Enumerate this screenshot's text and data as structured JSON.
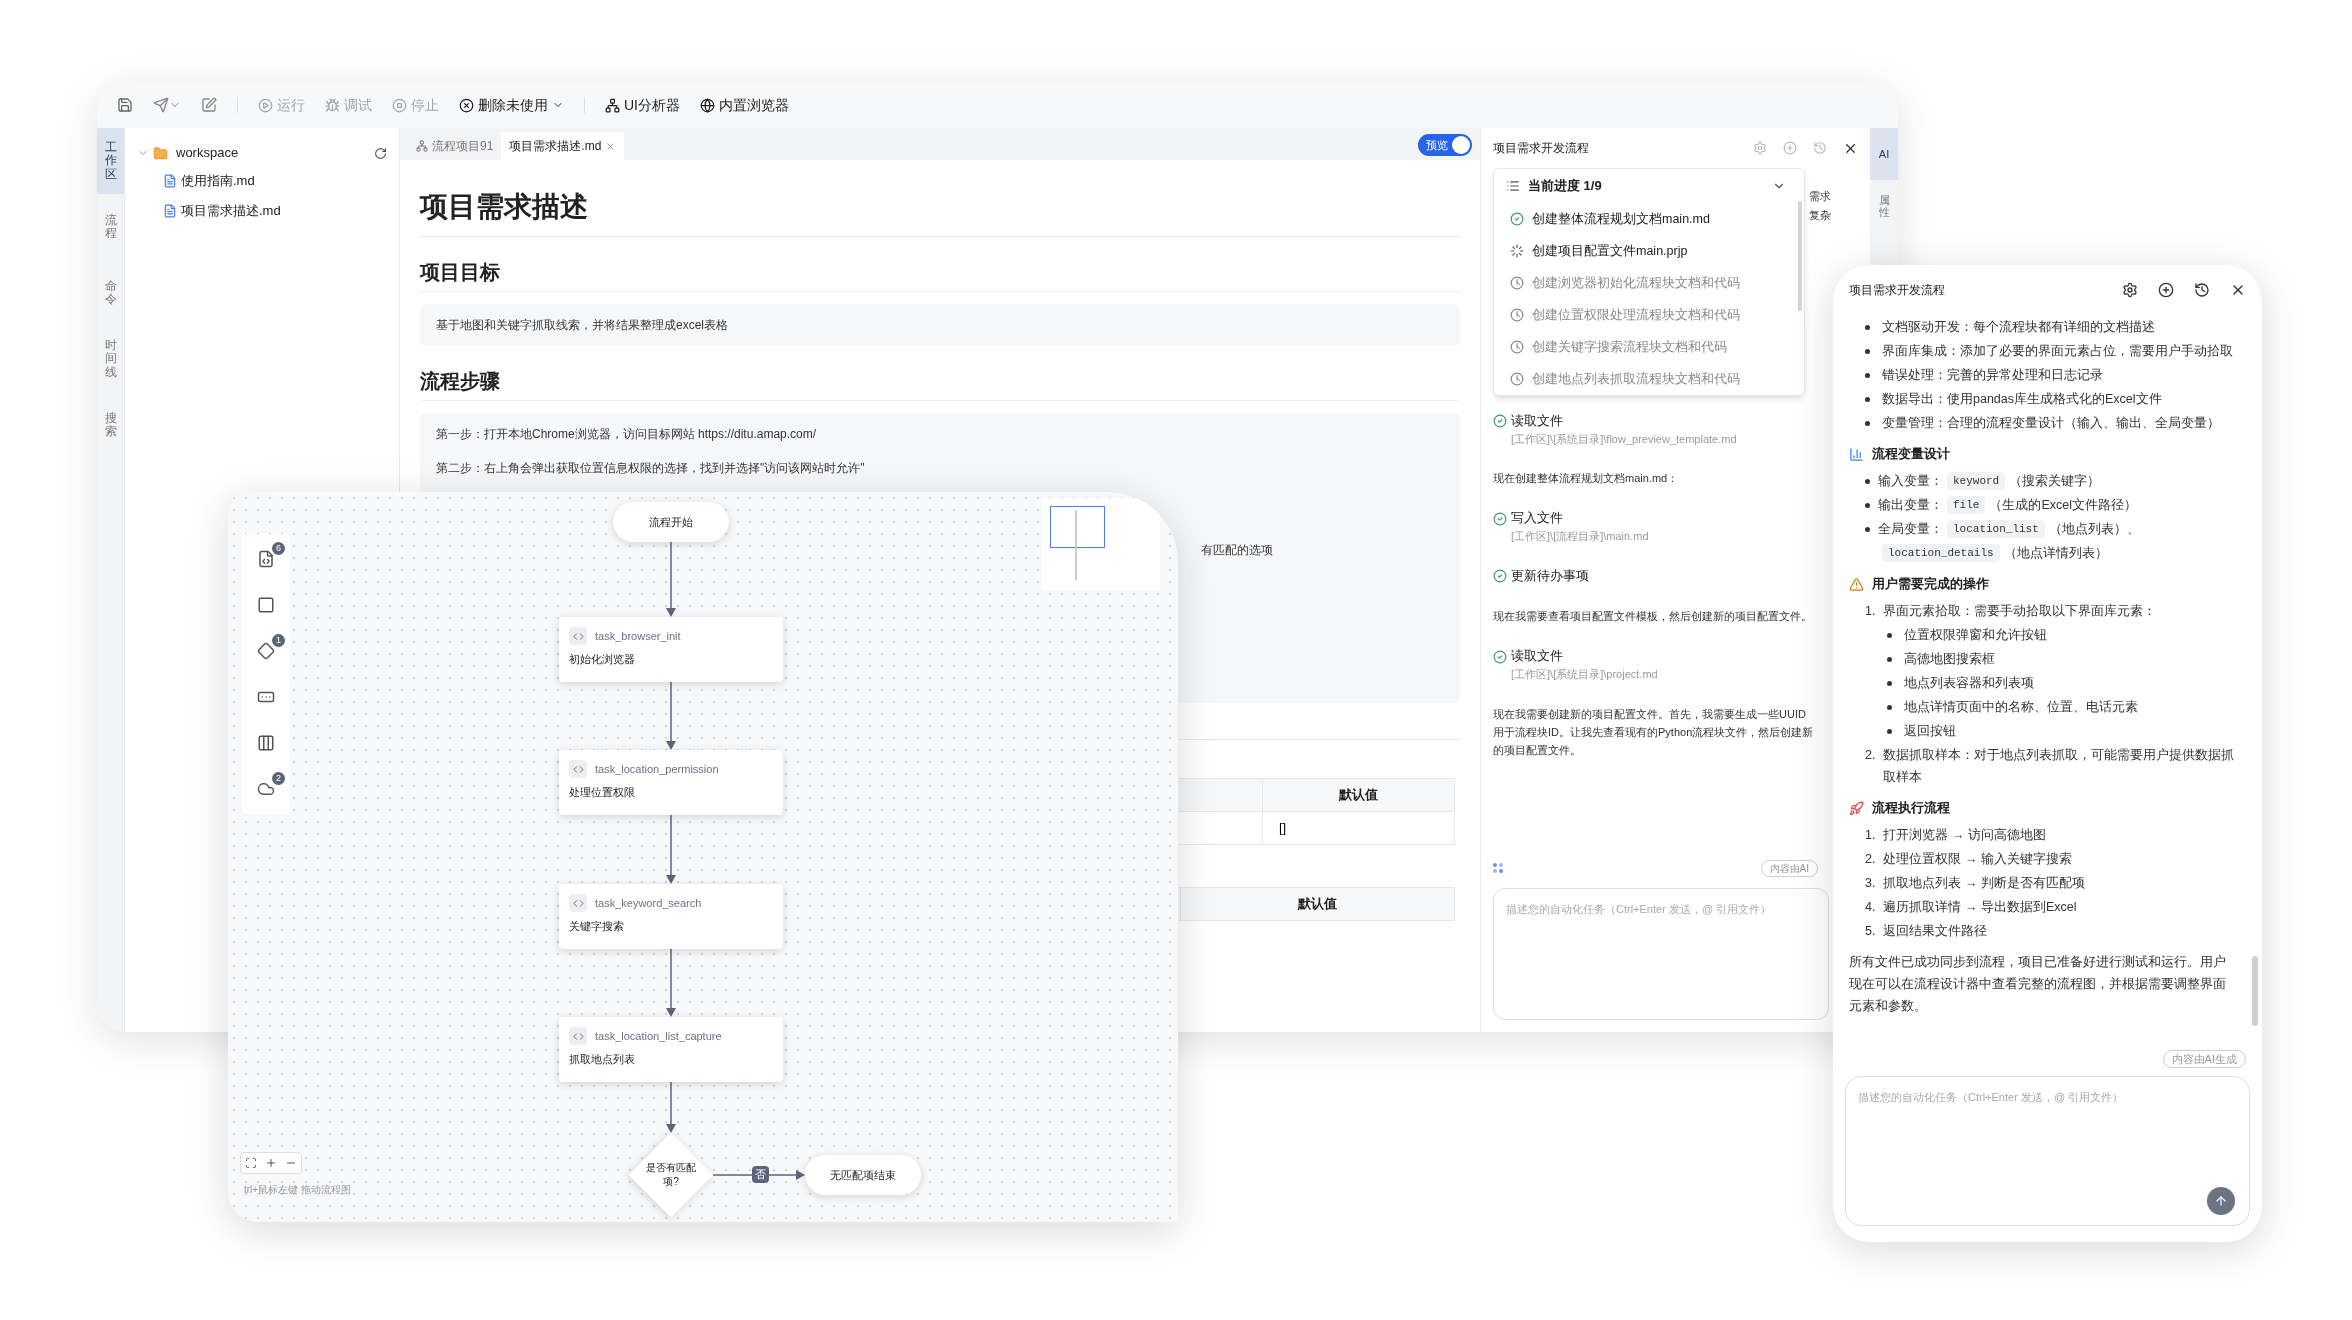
{
  "toolbar": {
    "buttons": [
      {
        "label": "运行",
        "disabled": true,
        "dropdown": false
      },
      {
        "label": "调试",
        "disabled": true,
        "dropdown": false
      },
      {
        "label": "停止",
        "disabled": true,
        "dropdown": false
      },
      {
        "label": "删除未使用",
        "disabled": false,
        "dropdown": true
      },
      {
        "label": "UI分析器",
        "disabled": false,
        "dropdown": false
      },
      {
        "label": "内置浏览器",
        "disabled": false,
        "dropdown": false
      }
    ]
  },
  "left_tabs": [
    {
      "label": "工作区",
      "selected": true
    },
    {
      "label": "流程",
      "selected": false
    },
    {
      "label": "命令",
      "selected": false
    },
    {
      "label": "时间线",
      "selected": false
    },
    {
      "label": "搜索",
      "selected": false
    }
  ],
  "explorer": {
    "root": {
      "label": "workspace",
      "expanded": true,
      "children": [
        {
          "label": "使用指南.md"
        },
        {
          "label": "项目需求描述.md"
        }
      ]
    }
  },
  "editor": {
    "tabs": [
      {
        "label": "流程项目91",
        "selected": false,
        "kind": "flow"
      },
      {
        "label": "项目需求描述.md",
        "selected": true,
        "kind": "file"
      }
    ],
    "preview": {
      "label": "预览",
      "on": true
    },
    "doc": {
      "title": "项目需求描述",
      "goal_heading": "项目目标",
      "goal_text": "基于地图和关键字抓取线索，并将结果整理成excel表格",
      "steps_heading": "流程步骤",
      "steps": [
        "第一步：打开本地Chrome浏览器，访问目标网站 https://ditu.amap.com/",
        "第二步：右上角会弹出获取位置信息权限的选择，找到并选择\"访问该网站时允许\""
      ],
      "fragment": "有匹配的选项",
      "tables": [
        {
          "columns": [
            "默认值"
          ],
          "rows": [
            [
              "[]"
            ]
          ]
        },
        {
          "columns": [
            "默认值"
          ]
        }
      ]
    }
  },
  "right_rail": [
    {
      "label": "AI",
      "selected": true
    },
    {
      "label": "属性",
      "selected": false
    }
  ],
  "chat": {
    "title": "项目需求开发流程",
    "progress": {
      "title": "当前进度 1/9",
      "expanded": true,
      "items": [
        {
          "label": "创建整体流程规划文档main.md",
          "done": true,
          "active": false
        },
        {
          "label": "创建项目配置文件main.prjp",
          "done": false,
          "active": true
        },
        {
          "label": "创建浏览器初始化流程块文档和代码",
          "done": false,
          "active": false
        },
        {
          "label": "创建位置权限处理流程块文档和代码",
          "done": false,
          "active": false
        },
        {
          "label": "创建关键字搜索流程块文档和代码",
          "done": false,
          "active": false
        },
        {
          "label": "创建地点列表抓取流程块文档和代码",
          "done": false,
          "active": false
        }
      ]
    },
    "behind": [
      "需求",
      "复杂"
    ],
    "messages": [
      {
        "kind": "tool",
        "title": "读取文件",
        "path": "[工作区]\\[系统目录]\\flow_preview_template.md",
        "done": true
      },
      {
        "kind": "text",
        "text": "现在创建整体流程规划文档main.md："
      },
      {
        "kind": "tool",
        "title": "写入文件",
        "path": "[工作区]\\[流程目录]\\main.md",
        "done": true
      },
      {
        "kind": "tool",
        "title": "更新待办事项",
        "done": true
      },
      {
        "kind": "text",
        "text": "现在我需要查看项目配置文件模板，然后创建新的项目配置文件。"
      },
      {
        "kind": "tool",
        "title": "读取文件",
        "path": "[工作区]\\[系统目录]\\project.md",
        "done": true
      },
      {
        "kind": "text",
        "text": "现在我需要创建新的项目配置文件。首先，我需要生成一些UUID用于流程块ID。让我先查看现有的Python流程块文件，然后创建新的项目配置文件。"
      }
    ],
    "ai_badge": "内容由AI",
    "input": {
      "placeholder": "描述您的自动化任务（Ctrl+Enter 发送，@ 引用文件）"
    }
  },
  "flow": {
    "palette": [
      {
        "kind": "script",
        "badge": "6"
      },
      {
        "kind": "process"
      },
      {
        "kind": "decision",
        "badge": "1"
      },
      {
        "kind": "terminal"
      },
      {
        "kind": "panel"
      },
      {
        "kind": "subflow",
        "badge": "2"
      }
    ],
    "nodes": [
      {
        "kind": "terminal",
        "label": "流程开始"
      },
      {
        "kind": "task",
        "name": "task_browser_init",
        "label": "初始化浏览器"
      },
      {
        "kind": "task",
        "name": "task_location_permission",
        "label": "处理位置权限"
      },
      {
        "kind": "task",
        "name": "task_keyword_search",
        "label": "关键字搜索"
      },
      {
        "kind": "task",
        "name": "task_location_list_capture",
        "label": "抓取地点列表"
      },
      {
        "kind": "decision",
        "label": "是否有匹配项?"
      },
      {
        "kind": "terminal",
        "label": "无匹配项结束"
      }
    ],
    "branch_label": "否",
    "hint": "trl+鼠标左键 拖动流程图"
  },
  "assistant": {
    "title": "项目需求开发流程",
    "intro_items": [
      "文档驱动开发：每个流程块都有详细的文档描述",
      "界面库集成：添加了必要的界面元素占位，需要用户手动拾取",
      "错误处理：完善的异常处理和日志记录",
      "数据导出：使用pandas库生成格式化的Excel文件",
      "变量管理：合理的流程变量设计（输入、输出、全局变量）"
    ],
    "sections": [
      {
        "title": "流程变量设计",
        "kind": "bullets",
        "items": [
          {
            "parts": [
              {
                "kind": "text",
                "text": "输入变量："
              },
              {
                "kind": "code",
                "text": "keyword"
              },
              {
                "kind": "text",
                "text": "（搜索关键字）"
              }
            ]
          },
          {
            "parts": [
              {
                "kind": "text",
                "text": "输出变量："
              },
              {
                "kind": "code",
                "text": "file"
              },
              {
                "kind": "text",
                "text": "（生成的Excel文件路径）"
              }
            ]
          },
          {
            "parts": [
              {
                "kind": "text",
                "text": "全局变量："
              },
              {
                "kind": "code",
                "text": "location_list"
              },
              {
                "kind": "text",
                "text": "（地点列表）、"
              },
              {
                "kind": "code",
                "text": "location_details"
              },
              {
                "kind": "text",
                "text": "（地点详情列表）"
              }
            ]
          }
        ]
      },
      {
        "title": "用户需要完成的操作",
        "kind": "numbered",
        "items": [
          {
            "number": "1.",
            "text": "界面元素拾取：需要手动拾取以下界面库元素：",
            "children": [
              "位置权限弹窗和允许按钮",
              "高德地图搜索框",
              "地点列表容器和列表项",
              "地点详情页面中的名称、位置、电话元素",
              "返回按钮"
            ]
          },
          {
            "number": "2.",
            "text": "数据抓取样本：对于地点列表抓取，可能需要用户提供数据抓取样本"
          }
        ]
      },
      {
        "title": "流程执行流程",
        "kind": "numbered",
        "items": [
          {
            "number": "1.",
            "text": "打开浏览器 → 访问高德地图"
          },
          {
            "number": "2.",
            "text": "处理位置权限 → 输入关键字搜索"
          },
          {
            "number": "3.",
            "text": "抓取地点列表 → 判断是否有匹配项"
          },
          {
            "number": "4.",
            "text": "遍历抓取详情 → 导出数据到Excel"
          },
          {
            "number": "5.",
            "text": "返回结果文件路径"
          }
        ]
      }
    ],
    "summary": "所有文件已成功同步到流程，项目已准备好进行测试和运行。用户现在可以在流程设计器中查看完整的流程图，并根据需要调整界面元素和参数。",
    "ai_badge": "内容由AI生成",
    "input": {
      "placeholder": "描述您的自动化任务（Ctrl+Enter 发送，@ 引用文件）"
    }
  }
}
